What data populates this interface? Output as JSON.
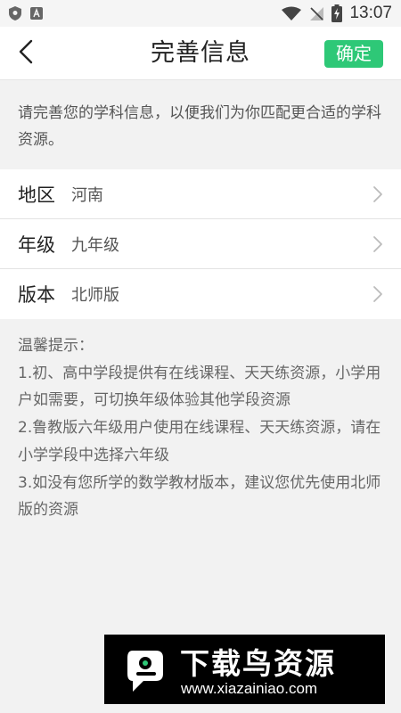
{
  "status_bar": {
    "time": "13:07",
    "left_icons": [
      "shield-icon",
      "a-icon"
    ],
    "right_icons": [
      "wifi-icon",
      "signal-off-icon",
      "battery-charging-icon"
    ]
  },
  "header": {
    "back_icon": "chevron-left-icon",
    "title": "完善信息",
    "confirm_label": "确定"
  },
  "notice": {
    "text": "请完善您的学科信息，以便我们为你匹配更合适的学科资源。"
  },
  "form": {
    "rows": [
      {
        "label": "地区",
        "value": "河南"
      },
      {
        "label": "年级",
        "value": "九年级"
      },
      {
        "label": "版本",
        "value": "北师版"
      }
    ]
  },
  "tips": {
    "title": "温馨提示：",
    "items": [
      "1.初、高中学段提供有在线课程、天天练资源，小学用户如需要，可切换年级体验其他学段资源",
      "2.鲁教版六年级用户使用在线课程、天天练资源，请在小学学段中选择六年级",
      "3.如没有您所学的数学教材版本，建议您优先使用北师版的资源"
    ]
  },
  "watermark": {
    "title": "下载鸟资源",
    "url": "www.xiazainiao.com"
  },
  "colors": {
    "accent": "#2ec877",
    "page_background": "#f2f2f2",
    "card_background": "#ffffff"
  }
}
